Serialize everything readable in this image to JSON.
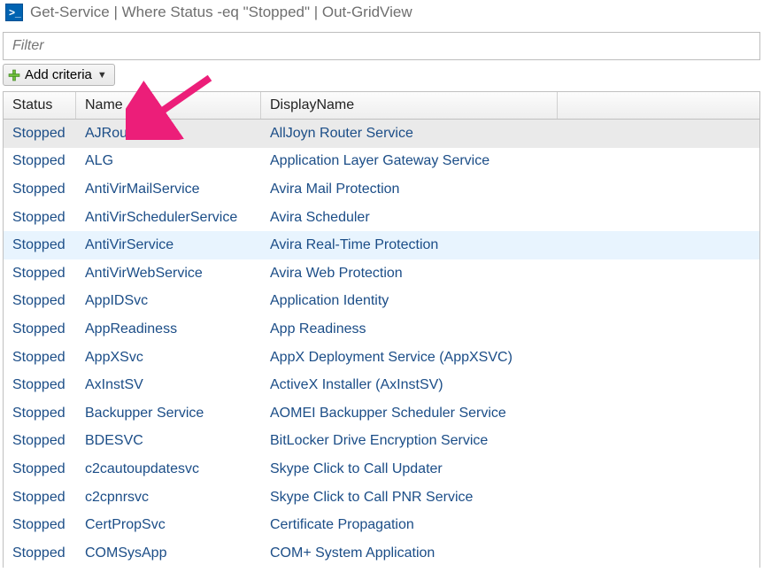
{
  "window": {
    "title": "Get-Service | Where Status -eq \"Stopped\" | Out-GridView"
  },
  "filter": {
    "placeholder": "Filter",
    "value": ""
  },
  "criteria": {
    "add_label": "Add criteria"
  },
  "grid": {
    "headers": {
      "status": "Status",
      "name": "Name",
      "display": "DisplayName"
    },
    "rows": [
      {
        "status": "Stopped",
        "name": "AJRouter",
        "display": "AllJoyn Router Service",
        "selected": true
      },
      {
        "status": "Stopped",
        "name": "ALG",
        "display": "Application Layer Gateway Service"
      },
      {
        "status": "Stopped",
        "name": "AntiVirMailService",
        "display": "Avira Mail Protection"
      },
      {
        "status": "Stopped",
        "name": "AntiVirSchedulerService",
        "display": "Avira Scheduler"
      },
      {
        "status": "Stopped",
        "name": "AntiVirService",
        "display": "Avira Real-Time Protection",
        "highlight": true
      },
      {
        "status": "Stopped",
        "name": "AntiVirWebService",
        "display": "Avira Web Protection"
      },
      {
        "status": "Stopped",
        "name": "AppIDSvc",
        "display": "Application Identity"
      },
      {
        "status": "Stopped",
        "name": "AppReadiness",
        "display": "App Readiness"
      },
      {
        "status": "Stopped",
        "name": "AppXSvc",
        "display": "AppX Deployment Service (AppXSVC)"
      },
      {
        "status": "Stopped",
        "name": "AxInstSV",
        "display": "ActiveX Installer (AxInstSV)"
      },
      {
        "status": "Stopped",
        "name": "Backupper Service",
        "display": "AOMEI Backupper Scheduler Service"
      },
      {
        "status": "Stopped",
        "name": "BDESVC",
        "display": "BitLocker Drive Encryption Service"
      },
      {
        "status": "Stopped",
        "name": "c2cautoupdatesvc",
        "display": "Skype Click to Call Updater"
      },
      {
        "status": "Stopped",
        "name": "c2cpnrsvc",
        "display": "Skype Click to Call PNR Service"
      },
      {
        "status": "Stopped",
        "name": "CertPropSvc",
        "display": "Certificate Propagation"
      },
      {
        "status": "Stopped",
        "name": "COMSysApp",
        "display": "COM+ System Application"
      }
    ]
  }
}
